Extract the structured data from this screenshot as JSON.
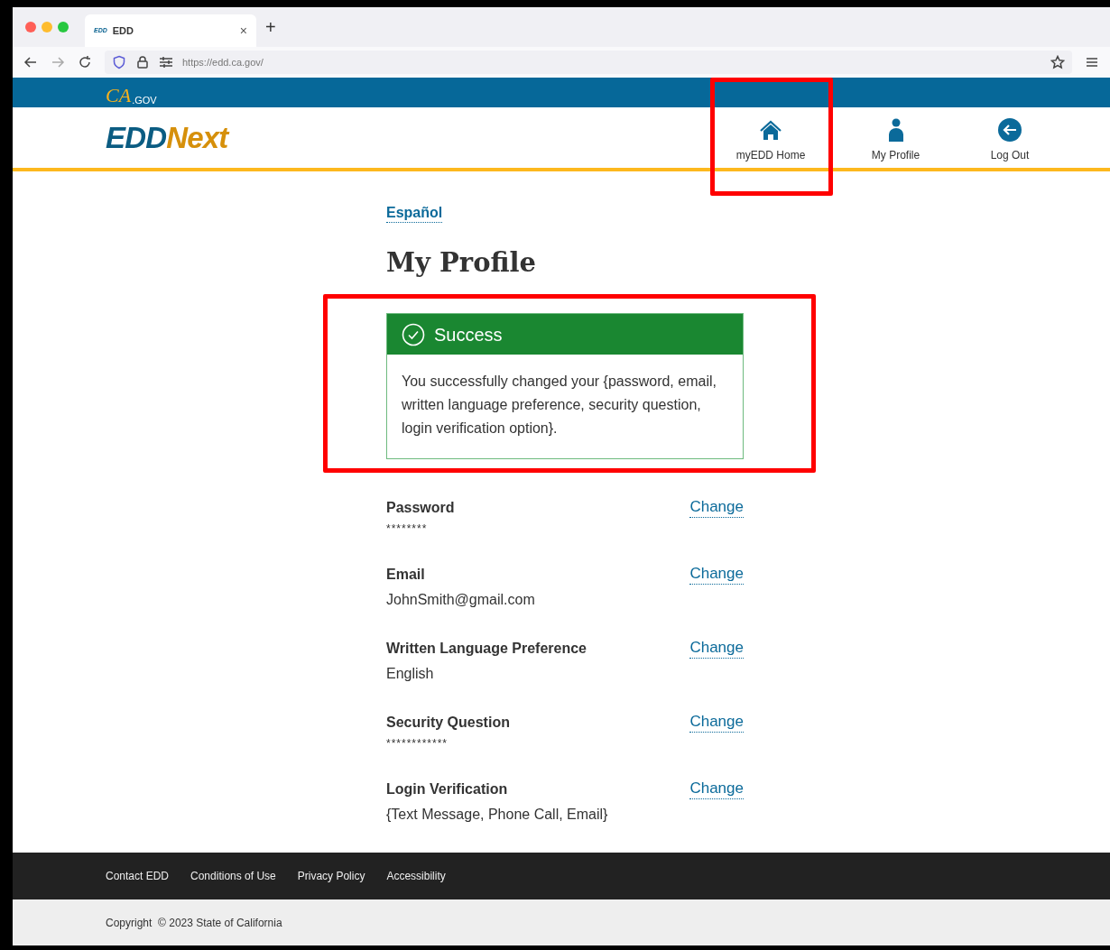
{
  "browser": {
    "tab_title": "EDD",
    "tab_favicon": "EDD",
    "close": "×",
    "new_tab": "+",
    "url": "https://edd.ca.gov/"
  },
  "top_bar": {
    "logo_ca": "CA",
    "logo_gov": ".GOV"
  },
  "header": {
    "logo_edd": "EDD",
    "logo_next": "Next",
    "nav": [
      {
        "label": "myEDD Home",
        "kind": "home",
        "highlighted": true
      },
      {
        "label": "My Profile",
        "kind": "profile",
        "highlighted": false
      },
      {
        "label": "Log Out",
        "kind": "logout",
        "highlighted": false
      }
    ]
  },
  "language_link": "Español",
  "title": "My Profile",
  "alert": {
    "heading": "Success",
    "message": "You successfully changed your {password, email, written language preference, security question, login verification option}.",
    "highlighted": true
  },
  "fields": [
    {
      "label": "Password",
      "value": "********",
      "masked": true,
      "action": "Change"
    },
    {
      "label": "Email",
      "value": "JohnSmith@gmail.com",
      "masked": false,
      "action": "Change"
    },
    {
      "label": "Written Language Preference",
      "value": "English",
      "masked": false,
      "action": "Change"
    },
    {
      "label": "Security Question",
      "value": "************",
      "masked": true,
      "action": "Change"
    },
    {
      "label": "Login Verification",
      "value": "{Text Message, Phone Call, Email}",
      "masked": false,
      "action": "Change"
    }
  ],
  "footer": {
    "links": [
      "Contact EDD",
      "Conditions of Use",
      "Privacy Policy",
      "Accessibility"
    ],
    "copyright": "Copyright  © 2023 State of California"
  }
}
